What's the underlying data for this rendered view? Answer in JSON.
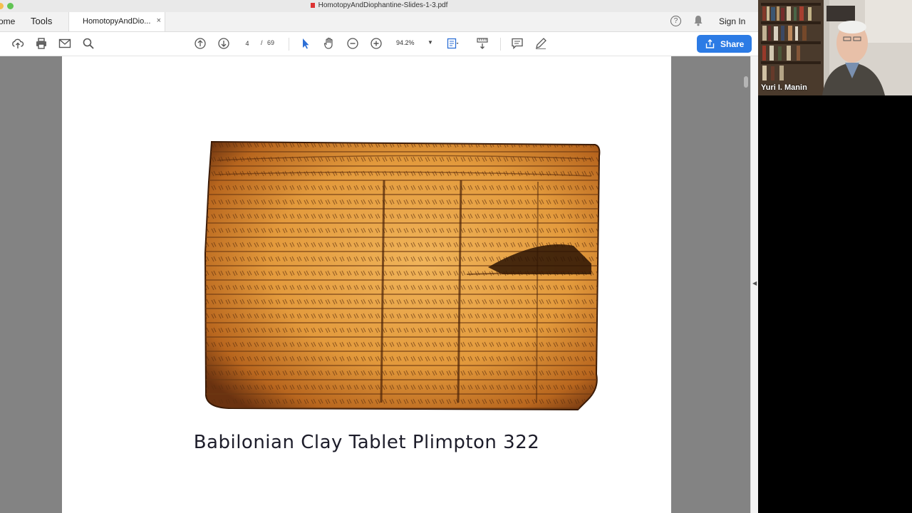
{
  "window": {
    "title": "HomotopyAndDiophantine-Slides-1-3.pdf"
  },
  "tabs": {
    "home_label": "ome",
    "tools_label": "Tools",
    "doc_label": "HomotopyAndDio...",
    "close_glyph": "×",
    "help_glyph": "?",
    "sign_in": "Sign In"
  },
  "toolbar": {
    "current_page": "4",
    "separator": "/",
    "total_pages": "69",
    "zoom": "94.2%",
    "share_label": "Share",
    "accent": "#2c7be5"
  },
  "document": {
    "caption": "Babilonian Clay Tablet Plimpton 322"
  },
  "video": {
    "participant_name": "Yuri I. Manin"
  }
}
